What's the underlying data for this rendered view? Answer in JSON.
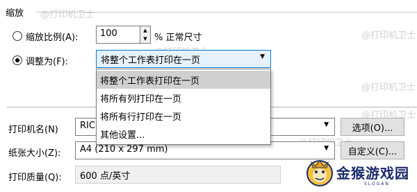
{
  "section": {
    "title": "缩放"
  },
  "scale": {
    "option_label": "缩放比例(A):",
    "value": "100",
    "suffix": "% 正常尺寸",
    "up_glyph": "▲",
    "down_glyph": "▼"
  },
  "fit": {
    "option_label": "调整为(F):",
    "selected_value": "将整个工作表打印在一页",
    "arrow_glyph": "▼",
    "options": [
      "将整个工作表打印在一页",
      "将所有列打印在一页",
      "将所有行打印在一页",
      "其他设置..."
    ]
  },
  "printer": {
    "label": "打印机名(N)",
    "value": "RIC",
    "arrow_glyph": "▼",
    "options_button": "选项(O)..."
  },
  "paper": {
    "label": "纸张大小(Z):",
    "value": "A4 (210 x 297 mm)",
    "arrow_glyph": "▼",
    "custom_button": "自定义(C)..."
  },
  "quality": {
    "label": "打印质量(Q):",
    "value": "600 点/英寸"
  },
  "watermarks": {
    "text": "@打印机卫士"
  },
  "logo": {
    "name": "金猴游戏园",
    "slogan": "SLOGAN"
  }
}
